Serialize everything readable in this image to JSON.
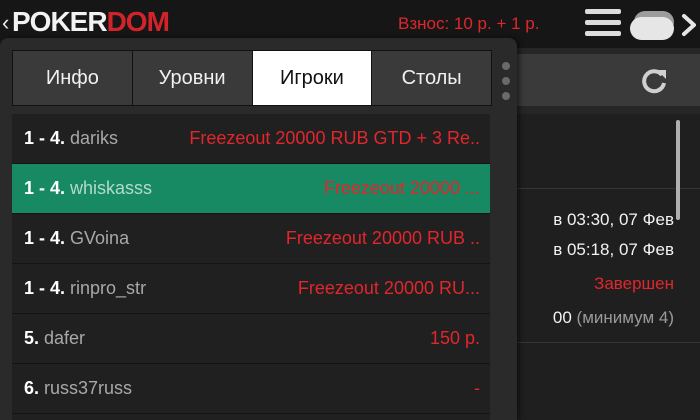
{
  "header": {
    "back": "‹",
    "logo_part1": "POKER",
    "logo_part2": "DOM",
    "fee": "Взнос: 10 р. + 1 р.",
    "icons": [
      "menu-icon",
      "tables-icon"
    ]
  },
  "tabs": [
    {
      "label": "Инфо"
    },
    {
      "label": "Уровни"
    },
    {
      "label": "Игроки"
    },
    {
      "label": "Столы"
    }
  ],
  "active_tab": "Игроки",
  "players": [
    {
      "rank": "1 - 4.",
      "name": "dariks",
      "prize": "Freezeout 20000 RUB GTD + 3 Re.."
    },
    {
      "rank": "1 - 4.",
      "name": "whiskasss",
      "prize": "Freezeout 20000 ..."
    },
    {
      "rank": "1 - 4.",
      "name": "GVoina",
      "prize": "Freezeout 20000 RUB .."
    },
    {
      "rank": "1 - 4.",
      "name": "rinpro_str",
      "prize": "Freezeout 20000 RU..."
    },
    {
      "rank": "5.",
      "name": "dafer",
      "prize": "150 р."
    },
    {
      "rank": "6.",
      "name": "russ37russ",
      "prize": "-"
    }
  ],
  "background_info": {
    "line1": "в 03:30, 07 Фев",
    "line2": "в 05:18, 07 Фев",
    "status": "Завершен",
    "line4_value": "00",
    "line4_note": "(минимум 4)"
  },
  "colors": {
    "accent_red": "#e1262c",
    "selected_row": "#178a64",
    "active_tab_bg": "#ffffff"
  }
}
